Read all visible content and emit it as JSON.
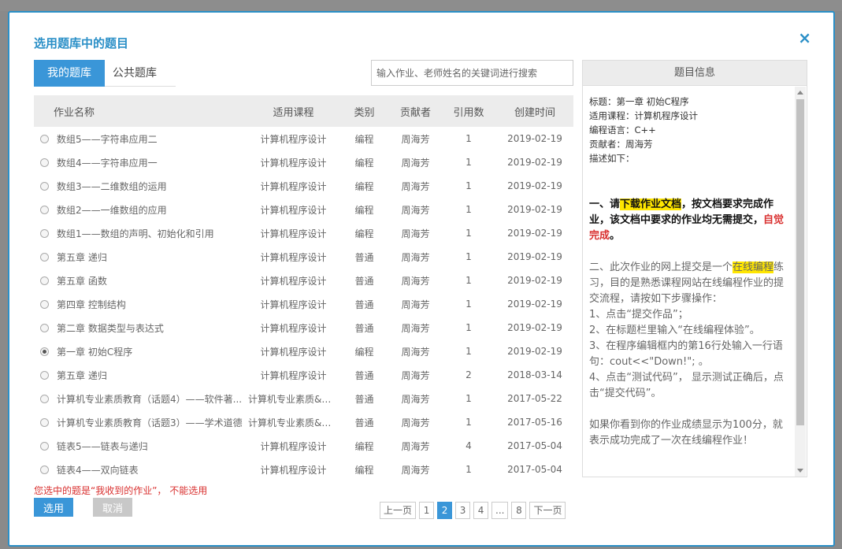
{
  "dialog": {
    "title": "选用题库中的题目",
    "close_label": "×"
  },
  "tabs": [
    {
      "label": "我的题库",
      "active": true
    },
    {
      "label": "公共题库",
      "active": false
    }
  ],
  "search": {
    "placeholder": "输入作业、老师姓名的关键词进行搜索",
    "value": ""
  },
  "table": {
    "headers": [
      "作业名称",
      "适用课程",
      "类别",
      "贡献者",
      "引用数",
      "创建时间"
    ],
    "rows": [
      {
        "name": "数组5——字符串应用二",
        "course": "计算机程序设计",
        "type": "编程",
        "author": "周海芳",
        "refs": "1",
        "date": "2019-02-19",
        "checked": false
      },
      {
        "name": "数组4——字符串应用一",
        "course": "计算机程序设计",
        "type": "编程",
        "author": "周海芳",
        "refs": "1",
        "date": "2019-02-19",
        "checked": false
      },
      {
        "name": "数组3——二维数组的运用",
        "course": "计算机程序设计",
        "type": "编程",
        "author": "周海芳",
        "refs": "1",
        "date": "2019-02-19",
        "checked": false
      },
      {
        "name": "数组2——一维数组的应用",
        "course": "计算机程序设计",
        "type": "编程",
        "author": "周海芳",
        "refs": "1",
        "date": "2019-02-19",
        "checked": false
      },
      {
        "name": "数组1——数组的声明、初始化和引用",
        "course": "计算机程序设计",
        "type": "编程",
        "author": "周海芳",
        "refs": "1",
        "date": "2019-02-19",
        "checked": false
      },
      {
        "name": "第五章 递归",
        "course": "计算机程序设计",
        "type": "普通",
        "author": "周海芳",
        "refs": "1",
        "date": "2019-02-19",
        "checked": false
      },
      {
        "name": "第五章 函数",
        "course": "计算机程序设计",
        "type": "普通",
        "author": "周海芳",
        "refs": "1",
        "date": "2019-02-19",
        "checked": false
      },
      {
        "name": "第四章 控制结构",
        "course": "计算机程序设计",
        "type": "普通",
        "author": "周海芳",
        "refs": "1",
        "date": "2019-02-19",
        "checked": false
      },
      {
        "name": "第二章 数据类型与表达式",
        "course": "计算机程序设计",
        "type": "普通",
        "author": "周海芳",
        "refs": "1",
        "date": "2019-02-19",
        "checked": false
      },
      {
        "name": "第一章 初始C程序",
        "course": "计算机程序设计",
        "type": "编程",
        "author": "周海芳",
        "refs": "1",
        "date": "2019-02-19",
        "checked": true
      },
      {
        "name": "第五章 递归",
        "course": "计算机程序设计",
        "type": "普通",
        "author": "周海芳",
        "refs": "2",
        "date": "2018-03-14",
        "checked": false
      },
      {
        "name": "计算机专业素质教育（话题4）——软件著...",
        "course": "计算机专业素质&办公应...",
        "type": "普通",
        "author": "周海芳",
        "refs": "1",
        "date": "2017-05-22",
        "checked": false
      },
      {
        "name": "计算机专业素质教育（话题3）——学术道德",
        "course": "计算机专业素质&办公应...",
        "type": "普通",
        "author": "周海芳",
        "refs": "1",
        "date": "2017-05-16",
        "checked": false
      },
      {
        "name": "链表5——链表与递归",
        "course": "计算机程序设计",
        "type": "编程",
        "author": "周海芳",
        "refs": "4",
        "date": "2017-05-04",
        "checked": false
      },
      {
        "name": "链表4——双向链表",
        "course": "计算机程序设计",
        "type": "编程",
        "author": "周海芳",
        "refs": "1",
        "date": "2017-05-04",
        "checked": false
      }
    ]
  },
  "error_message": "您选中的题是“我收到的作业”， 不能选用",
  "buttons": {
    "select": "选用",
    "cancel": "取消"
  },
  "pagination": {
    "prev": "上一页",
    "pages": [
      "1",
      "2",
      "3",
      "4",
      "...",
      "8"
    ],
    "active": "2",
    "next": "下一页"
  },
  "info": {
    "header": "题目信息",
    "meta": [
      "标题：第一章 初始C程序",
      "适用课程：计算机程序设计",
      "编程语言：C++",
      "贡献者：周海芳",
      "描述如下："
    ],
    "para1": {
      "t1": "一、请",
      "t2": "下载作业文档",
      "t3": "，按文档要求完成作业，该文档中要求的作业均无需提交，",
      "t4": "自觉完成",
      "t5": "。"
    },
    "para2": {
      "t1": "二、此次作业的网上提交是一个",
      "t2": "在线编程",
      "t3": "练习，目的是熟悉课程网站在线编程作业的提交流程，请按如下步骤操作：",
      "steps": [
        "1、点击“提交作品”；",
        "2、在标题栏里输入“在线编程体验”。",
        "3、在程序编辑框内的第16行处输入一行语句：cout<<\"Down!\"; 。",
        "4、点击“测试代码”， 显示测试正确后，点击“提交代码”。"
      ]
    },
    "para3": "如果你看到你的作业成绩显示为100分，就表示成功完成了一次在线编程作业！"
  }
}
